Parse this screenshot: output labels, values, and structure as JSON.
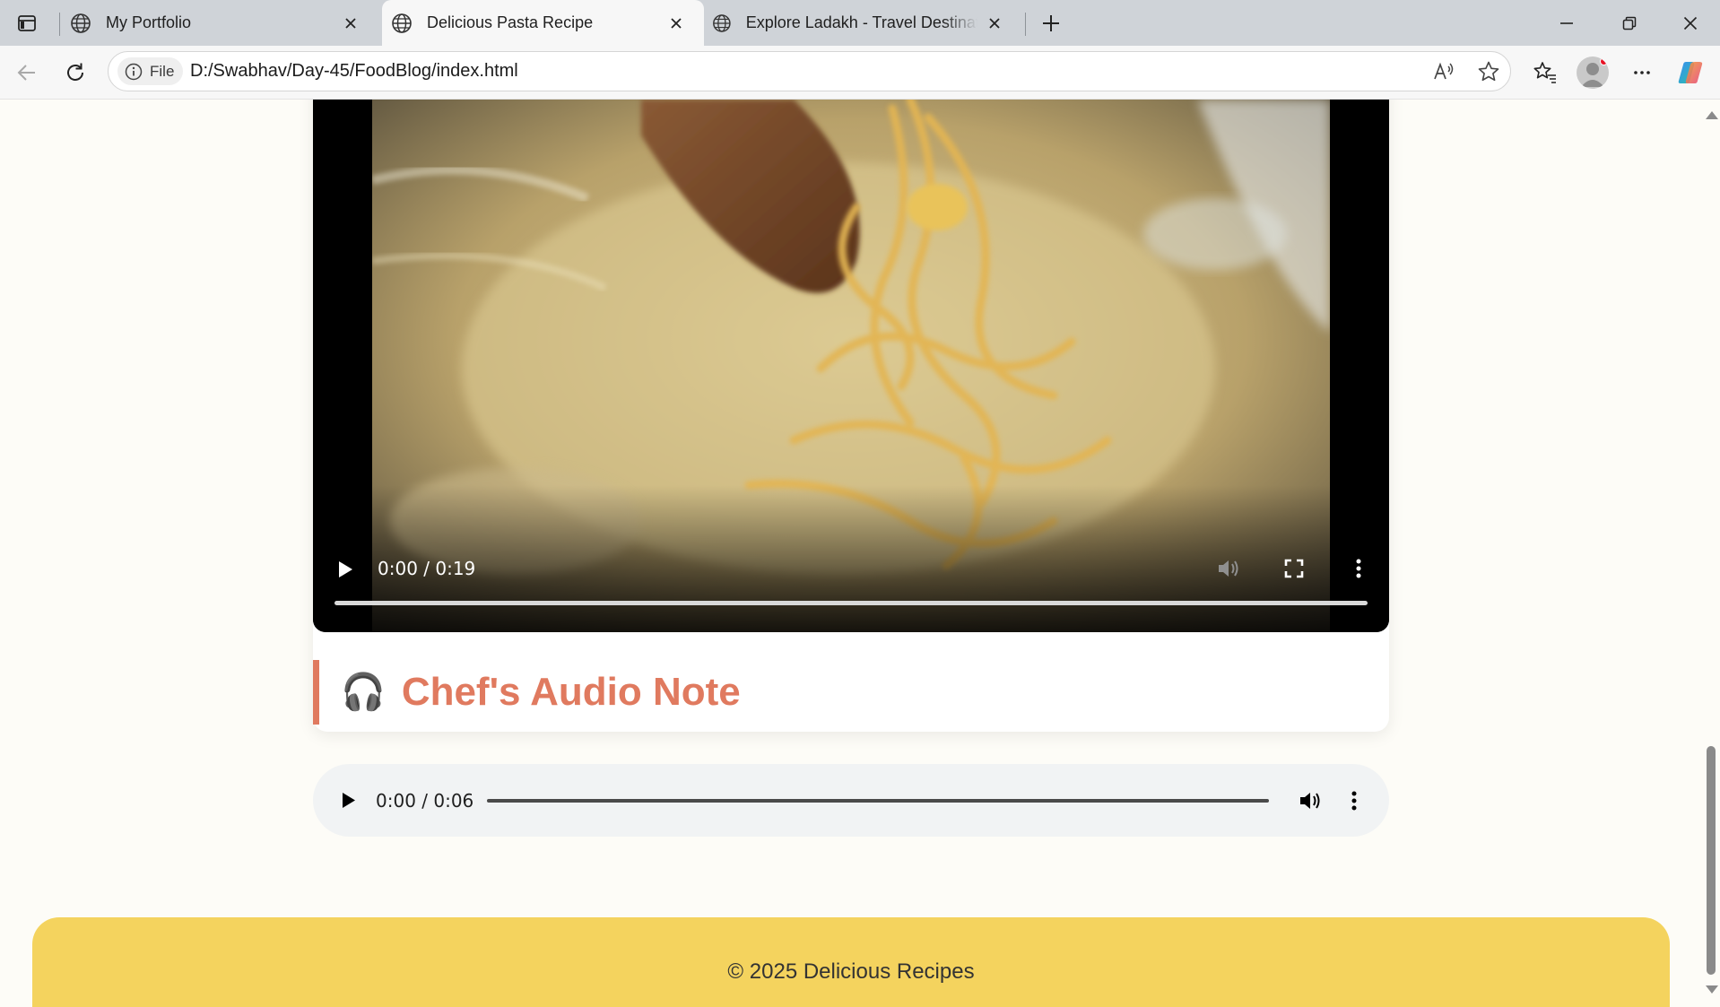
{
  "browser": {
    "tabs": [
      {
        "title": "My Portfolio",
        "icon": "globe-icon",
        "active": false
      },
      {
        "title": "Delicious Pasta Recipe",
        "icon": "globe-icon",
        "active": true
      },
      {
        "title": "Explore Ladakh - Travel Destination",
        "icon": "globe-icon",
        "active": false
      }
    ],
    "address": {
      "scheme_label": "File",
      "url": "D:/Swabhav/Day-45/FoodBlog/index.html"
    },
    "accent_color": "#e81123"
  },
  "page": {
    "video": {
      "time": "0:00 / 0:19",
      "progress": 0
    },
    "audio_section": {
      "icon": "🎧",
      "heading": "Chef's Audio Note"
    },
    "audio": {
      "time": "0:00 / 0:06",
      "progress": 0
    },
    "footer": {
      "copyright": "© 2025 Delicious Recipes"
    },
    "colors": {
      "heading_accent": "#e07a5f",
      "footer_bg": "#f4d35e",
      "page_bg": "#fdfcf7"
    }
  }
}
